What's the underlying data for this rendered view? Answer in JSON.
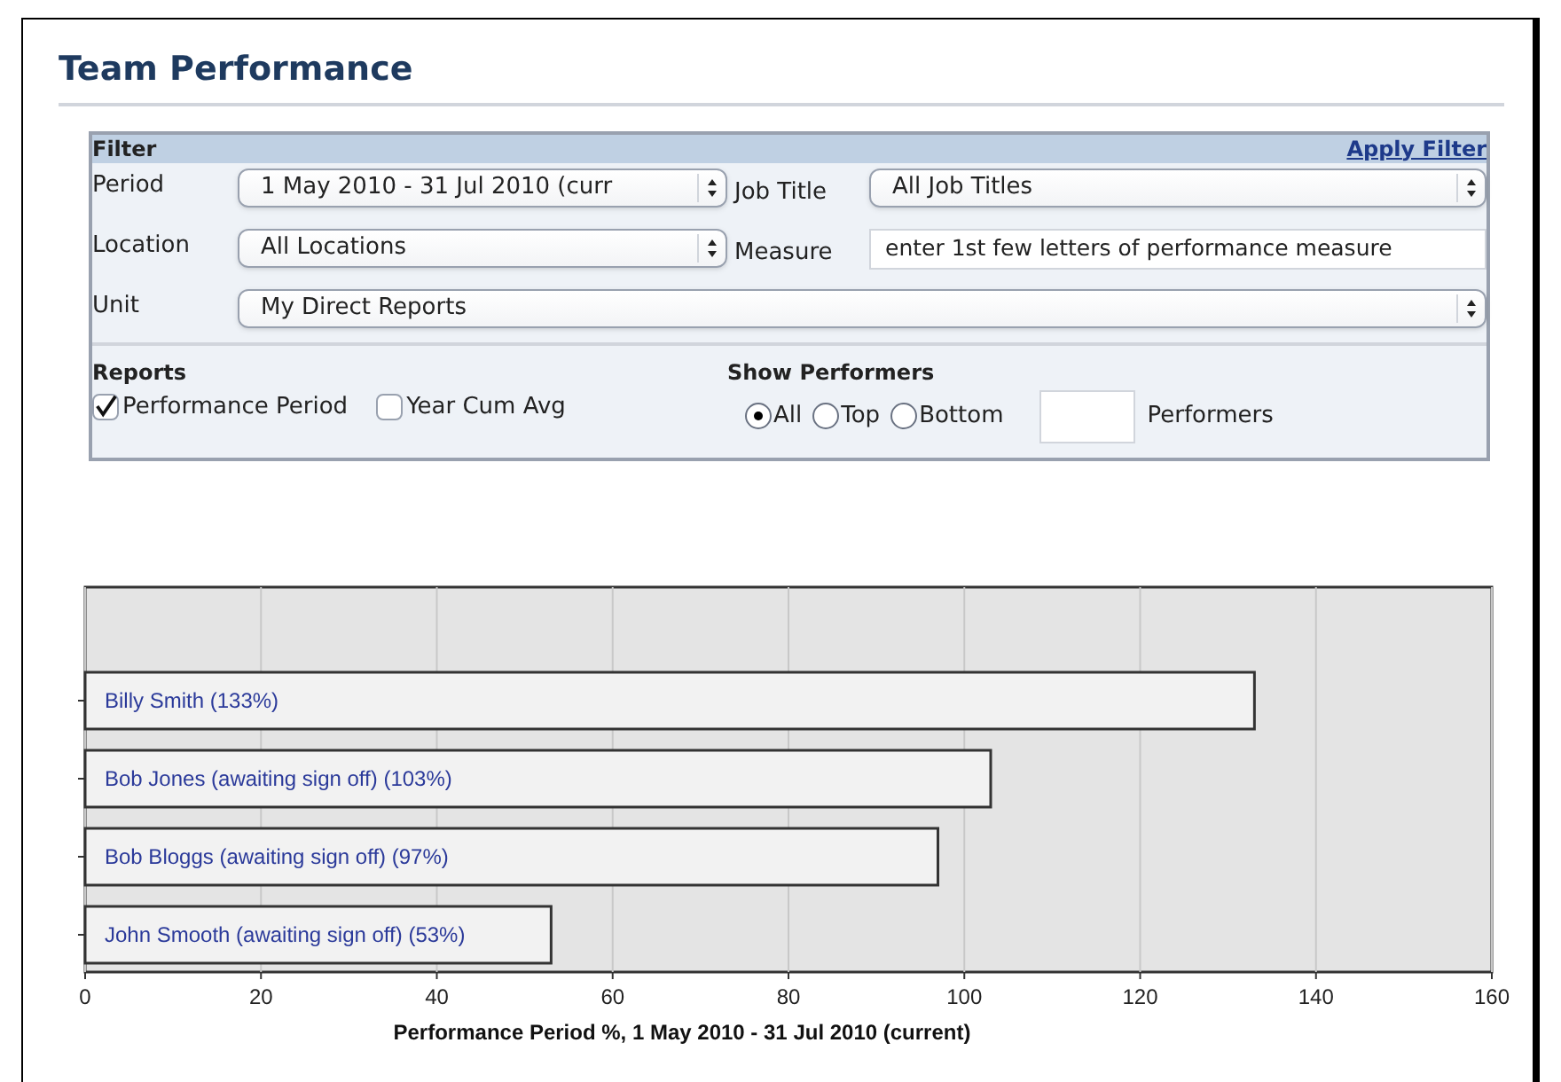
{
  "title": "Team Performance",
  "filter": {
    "heading": "Filter",
    "apply_link": "Apply Filter",
    "period": {
      "label": "Period",
      "value": "1 May 2010 - 31 Jul 2010 (curr"
    },
    "job_title": {
      "label": "Job Title",
      "value": "All Job Titles"
    },
    "location": {
      "label": "Location",
      "value": "All Locations"
    },
    "measure": {
      "label": "Measure",
      "value": "enter 1st few letters of performance measure"
    },
    "unit": {
      "label": "Unit",
      "value": "My Direct Reports"
    },
    "reports": {
      "heading": "Reports",
      "options": [
        {
          "label": "Performance Period",
          "checked": true
        },
        {
          "label": "Year Cum Avg",
          "checked": false
        }
      ]
    },
    "show_performers": {
      "heading": "Show Performers",
      "options": [
        {
          "label": "All",
          "selected": true
        },
        {
          "label": "Top",
          "selected": false
        },
        {
          "label": "Bottom",
          "selected": false
        }
      ],
      "count_label": "Performers"
    }
  },
  "chart": {
    "chart_data": {
      "type": "bar",
      "orientation": "horizontal",
      "xlabel": "Performance Period %, 1 May 2010 - 31 Jul 2010 (current)",
      "categories": [
        "Billy Smith (133%)",
        "Bob Jones (awaiting sign off) (103%)",
        "Bob Bloggs (awaiting sign off) (97%)",
        "John Smooth (awaiting sign off) (53%)"
      ],
      "series": [
        {
          "color": "#f2f2f2",
          "values": [
            133,
            103,
            97,
            53
          ]
        }
      ],
      "grid": true,
      "xlim": [
        0,
        160
      ],
      "xticks": [
        0,
        20,
        40,
        60,
        80,
        100,
        120,
        140,
        160
      ]
    }
  }
}
